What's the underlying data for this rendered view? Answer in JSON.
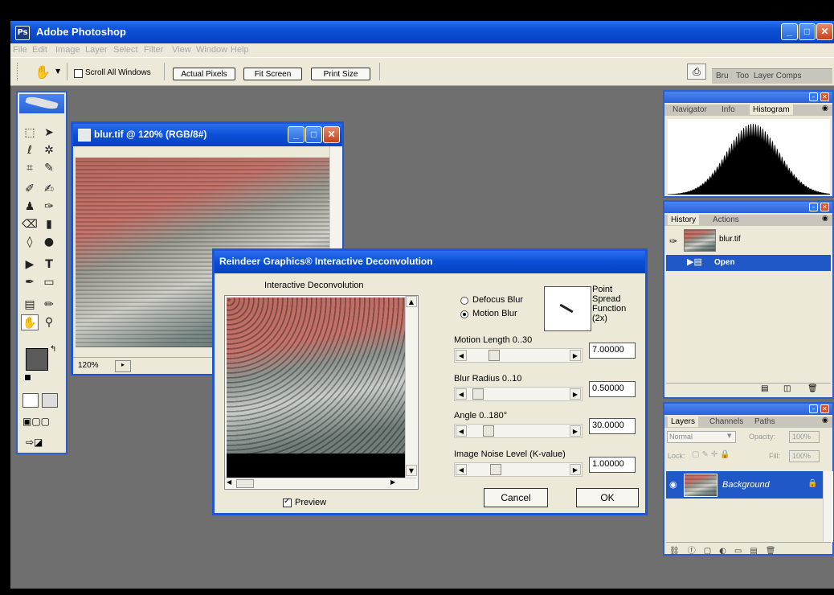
{
  "app": {
    "title": "Adobe Photoshop",
    "menu": [
      "File",
      "Edit",
      "Image",
      "Layer",
      "Select",
      "Filter",
      "View",
      "Window",
      "Help"
    ],
    "options": {
      "scroll_all_windows": "Scroll All Windows",
      "actual_pixels": "Actual Pixels",
      "fit_screen": "Fit Screen",
      "print_size": "Print Size"
    },
    "palette_well_tabs": [
      "Bru",
      "Too",
      "Layer Comps"
    ]
  },
  "document": {
    "title": "blur.tif @ 120% (RGB/8#)",
    "zoom": "120%"
  },
  "dialog": {
    "title": "Reindeer Graphics® Interactive Deconvolution",
    "preview_label": "Interactive Deconvolution",
    "defocus_blur": "Defocus Blur",
    "motion_blur": "Motion Blur",
    "psf_label_1": "Point",
    "psf_label_2": "Spread",
    "psf_label_3": "Function",
    "psf_label_4": "(2x)",
    "params": [
      {
        "label": "Motion Length 0..30",
        "value": "7.00000",
        "fraction": 0.23
      },
      {
        "label": "Blur Radius 0..10",
        "value": "0.50000",
        "fraction": 0.05
      },
      {
        "label": "Angle 0..180°",
        "value": "30.0000",
        "fraction": 0.17
      },
      {
        "label": "Image Noise Level (K-value)",
        "value": "1.00000",
        "fraction": 0.25
      }
    ],
    "preview_checkbox": "Preview",
    "cancel": "Cancel",
    "ok": "OK"
  },
  "panels": {
    "navigator": {
      "tabs": [
        "Navigator",
        "Info",
        "Histogram"
      ]
    },
    "history": {
      "tabs": [
        "History",
        "Actions"
      ],
      "snapshot": "blur.tif",
      "state": "Open"
    },
    "layers": {
      "tabs": [
        "Layers",
        "Channels",
        "Paths"
      ],
      "blend_mode": "Normal",
      "opacity_label": "Opacity:",
      "opacity_value": "100%",
      "lock_label": "Lock:",
      "fill_label": "Fill:",
      "fill_value": "100%",
      "layer_name": "Background"
    }
  },
  "colors": {
    "xp_blue": "#1d56d6",
    "selection_blue": "#2058c8",
    "chrome": "#ece9d8",
    "workspace": "#6f6f6f"
  }
}
